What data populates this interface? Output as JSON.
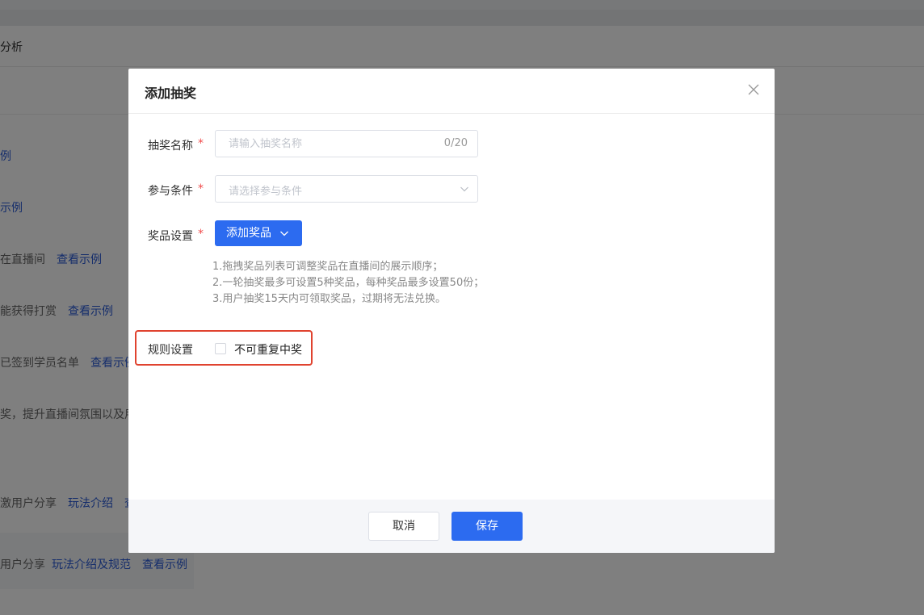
{
  "background": {
    "header_title": "分析",
    "rows": [
      {
        "prefix": "",
        "links": [
          "例"
        ]
      },
      {
        "prefix": "",
        "links": [
          "示例"
        ]
      },
      {
        "prefix": "在直播间",
        "links": [
          "查看示例"
        ]
      },
      {
        "prefix": "能获得打赏",
        "links": [
          "查看示例"
        ]
      },
      {
        "prefix": "已签到学员名单",
        "links": [
          "查看示例"
        ]
      },
      {
        "prefix": "奖，提升直播间氛围以及用",
        "links": []
      },
      {
        "prefix": "激用户分享",
        "links": [
          "玩法介绍",
          "查"
        ]
      },
      {
        "prefix": "用户分享",
        "links": [
          "玩法介绍及规范",
          "查看示例"
        ]
      }
    ]
  },
  "modal": {
    "title": "添加抽奖",
    "name_field": {
      "label": "抽奖名称",
      "required_mark": "*",
      "placeholder": "请输入抽奖名称",
      "value": "",
      "counter": "0/20"
    },
    "condition_field": {
      "label": "参与条件",
      "required_mark": "*",
      "placeholder": "请选择参与条件"
    },
    "prize_field": {
      "label": "奖品设置",
      "required_mark": "*",
      "add_button": "添加奖品",
      "hints": [
        "1.拖拽奖品列表可调整奖品在直播间的展示顺序；",
        "2.一轮抽奖最多可设置5种奖品，每种奖品最多设置50份；",
        "3.用户抽奖15天内可领取奖品，过期将无法兑换。"
      ]
    },
    "rule_field": {
      "label": "规则设置",
      "checkbox_label": "不可重复中奖",
      "checked": false
    },
    "footer": {
      "cancel": "取消",
      "save": "保存"
    }
  },
  "colors": {
    "primary": "#2c6bf0",
    "required": "#f04b4b",
    "highlight_border": "#e0432f"
  }
}
